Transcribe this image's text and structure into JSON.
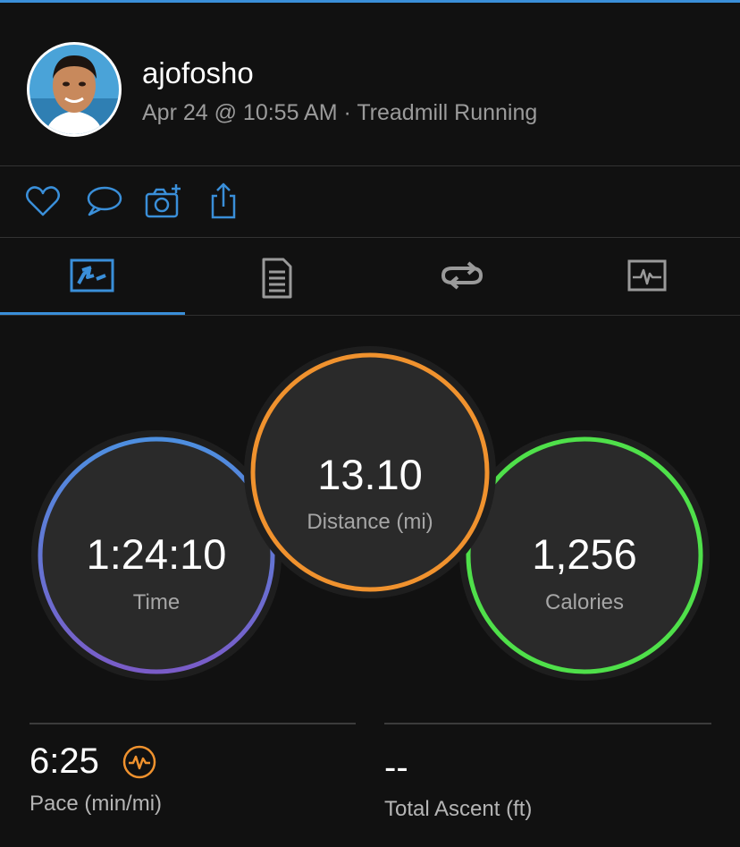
{
  "header": {
    "username": "ajofosho",
    "date": "Apr 24 @ 10:55 AM",
    "separator": " · ",
    "activity_type": "Treadmill Running"
  },
  "actions": [
    {
      "name": "like",
      "icon": "heart-icon"
    },
    {
      "name": "comment",
      "icon": "comment-icon"
    },
    {
      "name": "add-photo",
      "icon": "camera-plus-icon"
    },
    {
      "name": "share",
      "icon": "share-icon"
    }
  ],
  "tabs": [
    {
      "name": "overview",
      "icon": "activity-overview-icon",
      "active": true
    },
    {
      "name": "details",
      "icon": "document-list-icon",
      "active": false
    },
    {
      "name": "laps",
      "icon": "loop-icon",
      "active": false
    },
    {
      "name": "charts",
      "icon": "pulse-chart-icon",
      "active": false
    }
  ],
  "circles": {
    "time": {
      "value": "1:24:10",
      "label": "Time"
    },
    "distance": {
      "value": "13.10",
      "label": "Distance (mi)"
    },
    "calories": {
      "value": "1,256",
      "label": "Calories"
    }
  },
  "stats": {
    "pace": {
      "value": "6:25",
      "label": "Pace (min/mi)",
      "icon": "pace-badge-icon"
    },
    "ascent": {
      "value": "--",
      "label": "Total Ascent (ft)"
    }
  },
  "colors": {
    "accent": "#3a8fd9",
    "time_ring_top": "#4d8fe0",
    "time_ring_bottom": "#7a5cc8",
    "distance_ring": "#f0922e",
    "calories_ring": "#4fe04a",
    "background": "#111111"
  }
}
